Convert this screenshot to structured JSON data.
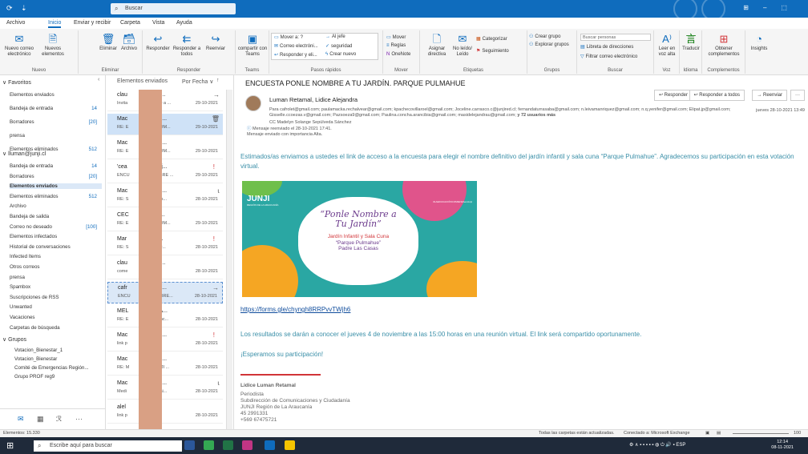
{
  "titlebar": {
    "search_placeholder": "Buscar"
  },
  "menu": {
    "tabs": [
      "Archivo",
      "Inicio",
      "Enviar y recibir",
      "Carpeta",
      "Vista",
      "Ayuda"
    ]
  },
  "ribbon": {
    "nuevo": {
      "correo": "Nuevo correo electrónico",
      "elementos": "Nuevos elementos",
      "label": "Nuevo"
    },
    "eliminar": {
      "eliminar": "Eliminar",
      "archivo": "Archivo",
      "label": "Eliminar"
    },
    "responder": {
      "responder": "Responder",
      "todos": "Responder a todos",
      "reenviar": "Reenviar",
      "label": "Responder"
    },
    "teams": {
      "compartir": "compartir con Teams",
      "label": "Teams"
    },
    "pasos": {
      "mover_a": "Mover a: ?",
      "al_jefe": "Al jefe",
      "correo_elec": "Correo electróni...",
      "seguridad": "seguridad",
      "responder_elim": "Responder y eli...",
      "crear_nuevo": "Crear nuevo",
      "label": "Pasos rápidos"
    },
    "mover": {
      "mover": "Mover",
      "reglas": "Reglas",
      "onenote": "OneNote",
      "label": "Mover"
    },
    "etiquetas": {
      "asignar": "Asignar directiva",
      "no_leido": "No leído/ Leído",
      "categorizar": "Categorizar",
      "seguimiento": "Seguimiento",
      "label": "Etiquetas"
    },
    "grupos": {
      "crear": "Crear grupo",
      "explorar": "Explorar grupos",
      "label": "Grupos"
    },
    "buscar": {
      "personas": "Buscar personas",
      "libreta": "Libreta de direcciones",
      "filtrar": "Filtrar correo electrónico",
      "label": "Buscar"
    },
    "voz": {
      "leer": "Leer en voz alta",
      "label": "Voz"
    },
    "idioma": {
      "traducir": "Traducir",
      "label": "Idioma"
    },
    "complementos": {
      "obtener": "Obtener complementos",
      "label": "Complementos"
    },
    "insights": {
      "insights": "Insights"
    }
  },
  "folders": {
    "favoritos": "Favoritos",
    "fav_items": [
      {
        "label": "Elementos enviados",
        "count": ""
      },
      {
        "label": "Bandeja de entrada",
        "count": "14"
      },
      {
        "label": "Borradores",
        "count": "[20]"
      },
      {
        "label": "prensa",
        "count": ""
      },
      {
        "label": "Elementos eliminados",
        "count": "512"
      }
    ],
    "account": "lluman@junji.cl",
    "acc_items": [
      {
        "label": "Bandeja de entrada",
        "count": "14"
      },
      {
        "label": "Borradores",
        "count": "[20]"
      },
      {
        "label": "Elementos enviados",
        "count": ""
      },
      {
        "label": "Elementos eliminados",
        "count": "512"
      },
      {
        "label": "Archivo",
        "count": ""
      },
      {
        "label": "Bandeja de salida",
        "count": ""
      },
      {
        "label": "Correo no deseado",
        "count": "[100]"
      },
      {
        "label": "Elementos infectados",
        "count": ""
      },
      {
        "label": "Historial de conversaciones",
        "count": ""
      },
      {
        "label": "Infected Items",
        "count": ""
      },
      {
        "label": "Otros correos",
        "count": ""
      },
      {
        "label": "prensa",
        "count": ""
      },
      {
        "label": "Spambox",
        "count": ""
      },
      {
        "label": "Suscripciones de RSS",
        "count": ""
      },
      {
        "label": "Unwanted",
        "count": ""
      },
      {
        "label": "Vacaciones",
        "count": ""
      },
      {
        "label": "Carpetas de búsqueda",
        "count": ""
      }
    ],
    "grupos": "Grupos",
    "group_items": [
      "Votacion_Bienestar_1",
      "Votacion_Bienestar",
      "Comité de Emergencias Región...",
      "Grupo PROF reg9"
    ]
  },
  "msglist": {
    "folder": "Elementos enviados",
    "sort": "Por Fecha",
    "items": [
      {
        "from": "clau",
        "subj": "..a@j...",
        "prev": "Invita",
        "prev2": "mbre a ...",
        "date": "29-10-2021"
      },
      {
        "from": "Mac",
        "subj": "ge Se...",
        "prev": "RE: E",
        "prev2": "E NOM...",
        "date": "29-10-2021"
      },
      {
        "from": "Mac",
        "subj": "ge Se...",
        "prev": "RE: E",
        "prev2": "E NOM...",
        "date": "29-10-2021"
      },
      {
        "from": "'cea",
        "subj": "ujci.c'j...",
        "prev": "ENCU",
        "prev2": "OMBRE ...",
        "date": "29-10-2021"
      },
      {
        "from": "Mac",
        "subj": "ge Se...",
        "prev": "RE: S",
        "prev2": "tenes...",
        "date": "28-10-2021"
      },
      {
        "from": "CEC",
        "subj": "ENA ...",
        "prev": "RE: E",
        "prev2": "E NOM...",
        "date": "29-10-2021"
      },
      {
        "from": "Mar",
        "subj": "- Gó...",
        "prev": "RE: S",
        "prev2": "tener...",
        "date": "28-10-2021"
      },
      {
        "from": "clau",
        "subj": "..a@j...",
        "prev": "come",
        "prev2": "ao",
        "date": "28-10-2021"
      },
      {
        "from": "cafr",
        "subj": ".com;...",
        "prev": "ENCU",
        "prev2": "OMBRE...",
        "date": "28-10-2021"
      },
      {
        "from": "MEL",
        "subj": "RZUA...",
        "prev": "RE: E",
        "prev2": "- Func...",
        "date": "28-10-2021"
      },
      {
        "from": "Mac",
        "subj": "ge Se...",
        "prev": "link p",
        "prev2": "",
        "date": "28-10-2021"
      },
      {
        "from": "Mac",
        "subj": "ge Se...",
        "prev": "RE: M",
        "prev2": "JUNJI ...",
        "date": "28-10-2021"
      },
      {
        "from": "Mac",
        "subj": "ge Se...",
        "prev": "Medi",
        "prev2": "in Pai...",
        "date": "28-10-2021"
      },
      {
        "from": "alel",
        "subj": "",
        "prev": "link p",
        "prev2": "",
        "date": "28-10-2021"
      }
    ]
  },
  "reading": {
    "subject": "ENCUESTA PONLE NOMBRE A TU JARDÍN. PARQUE PULMAHUE",
    "sender": "Luman Retamal, Lidice Alejandra",
    "to_label": "Para",
    "to": "cafrolet@gmail.com; paulamacka.rechalvear@gmail.com; kpachecovillaroel@gmail.com; Joceline.carrasco.c@junjired.cl; fernandaturrasaba@gmail.com; n.leivamanriquez@gmail.com; n.q.yenifer@gmail.com; Elipat.jp@gmail.com; Gisselle.ccoezas.v@gmail.com; Pazsoeza9@gmail.com; Paulina.concha.arancibia@gmail.com; masidelejandrau@gmail.com;",
    "to_more": "y 72 usuarios más",
    "cc_label": "CC",
    "cc": "Madelyn Solange Sepúlveda Sánchez",
    "fwd1": "Mensaje reenviado el 28-10-2021 17:41.",
    "fwd2": "Mensaje enviado con importancia Alta.",
    "date": "jueves 28-10-2021 13:49",
    "btn_responder": "Responder",
    "btn_todos": "Responder a todos",
    "btn_reenviar": "Reenviar",
    "p1": "Estimados/as enviamos a ustedes el link de acceso a la encuesta para elegir el nombre definitivo del jardín infantil y sala cuna “Parque Pulmahue”. Agradecemos su participación en esta votación virtual.",
    "banner_logo": "JUNJI",
    "banner_sub": "REGIÓN DE LA ARAUCANÍA",
    "banner_tag": "#LAEDUCACIÓNCOMIENZAenJunji",
    "banner_t1": "“Ponle Nombre a Tu Jardín”",
    "banner_t2a": "Jardín Infantil y Sala Cuna",
    "banner_t2b": "“Parque Pulmahue”",
    "banner_t2c": "Padre Las Casas",
    "link": "https://forms.gle/chyngh8RRPvvTWjh6",
    "p2": "Los resultados se darán a conocer el jueves 4 de noviembre a las 15:00 horas en una reunión virtual. El link será compartido oportunamente.",
    "p3": "¡Esperamos su participación!",
    "sig_name": "Lidice Luman Retamal",
    "sig_role": "Periodista",
    "sig_dept": "Subdirección de Comunicaciones y Ciudadanía",
    "sig_org": "JUNJI Región de La Araucanía",
    "sig_tel1": "45 2991331",
    "sig_tel2": "+569 67475721"
  },
  "status": {
    "left": "Elementos: 15.330",
    "mid": "Todas las carpetas están actualizadas.",
    "conn": "Conectado a: Microsoft Exchange",
    "zoom": "100"
  },
  "taskbar": {
    "search": "Escribe aquí para buscar",
    "lang": "ESP",
    "time": "12:14",
    "date": "08-11-2021"
  },
  "colors": {
    "accent": "#0f6cbd",
    "body_text": "#3a8fa8",
    "flag": "#d13438"
  }
}
